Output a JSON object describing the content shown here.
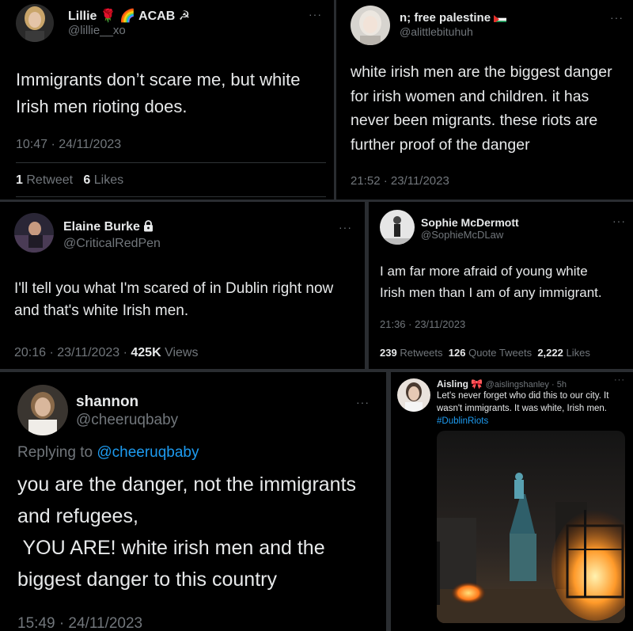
{
  "tweets": {
    "lillie": {
      "name": "Lillie",
      "name_suffix": "ACAB ☭",
      "handle": "@lillie__xo",
      "more": "···",
      "lines": [
        "Immigrants don’t scare me, but white",
        "Irish men rioting does."
      ],
      "timestamp": "10:47 · 24/11/2023",
      "retweets": "1",
      "retweets_label": "Retweet",
      "likes": "6",
      "likes_label": "Likes"
    },
    "free_palestine": {
      "name": "n; free palestine",
      "handle": "@alittlebituhuh",
      "more": "···",
      "lines": [
        "white irish men are the biggest danger",
        "for irish women and children. it has",
        "never been migrants. these riots are",
        "further proof of the danger"
      ],
      "timestamp": "21:52 · 23/11/2023"
    },
    "elaine": {
      "name": "Elaine Burke",
      "handle": "@CriticalRedPen",
      "more": "···",
      "lines": [
        "I'll tell you what I'm scared of in Dublin right now",
        "and that's white Irish men."
      ],
      "timestamp": "20:16 · 23/11/2023 · ",
      "views": "425K",
      "views_label": "Views"
    },
    "sophie": {
      "name": "Sophie McDermott",
      "handle": "@SophieMcDLaw",
      "more": "···",
      "lines": [
        "I am far more afraid of young white",
        "Irish men than I am of any immigrant."
      ],
      "timestamp": "21:36 · 23/11/2023",
      "retweets": "239",
      "retweets_label": "Retweets",
      "quotes": "126",
      "quotes_label": "Quote Tweets",
      "likes": "2,222",
      "likes_label": "Likes"
    },
    "shannon": {
      "name": "shannon",
      "handle": "@cheeruqbaby",
      "more": "···",
      "replying_prefix": "Replying to",
      "replying_handle": "@cheeruqbaby",
      "lines": [
        "you are the danger, not the immigrants",
        "and refugees,",
        " YOU ARE! white irish men and the",
        "biggest danger to this country"
      ],
      "timestamp": "15:49 · 24/11/2023"
    },
    "aisling": {
      "name": "Aisling",
      "handle_time": "@aislingshanley · 5h",
      "more": "···",
      "lines": [
        "Let's never forget who did this to our city. It",
        "wasn't immigrants. It was white, Irish men."
      ],
      "hashtag": "#DublinRiots"
    }
  }
}
